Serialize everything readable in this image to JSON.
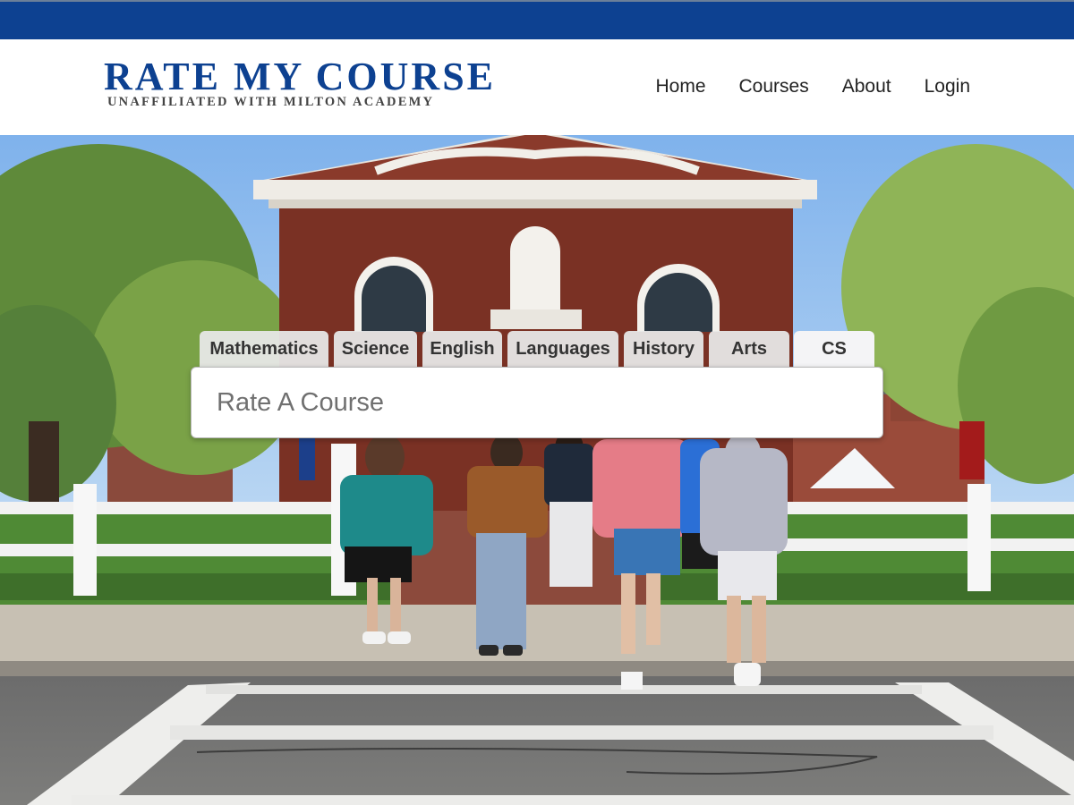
{
  "site": {
    "logo_title": "RATE MY COURSE",
    "logo_subtitle": "UNAFFILIATED WITH MILTON ACADEMY",
    "brand_color": "#0d4191"
  },
  "nav": {
    "items": [
      {
        "label": "Home"
      },
      {
        "label": "Courses"
      },
      {
        "label": "About"
      },
      {
        "label": "Login"
      }
    ]
  },
  "subjects": {
    "tabs": [
      {
        "label": "Mathematics"
      },
      {
        "label": "Science"
      },
      {
        "label": "English"
      },
      {
        "label": "Languages"
      },
      {
        "label": "History"
      },
      {
        "label": "Arts"
      },
      {
        "label": "CS",
        "selected": true
      }
    ]
  },
  "search": {
    "placeholder": "Rate A Course",
    "value": ""
  },
  "hero": {
    "image_semantic": "campus-photo-students-crossing-street"
  }
}
